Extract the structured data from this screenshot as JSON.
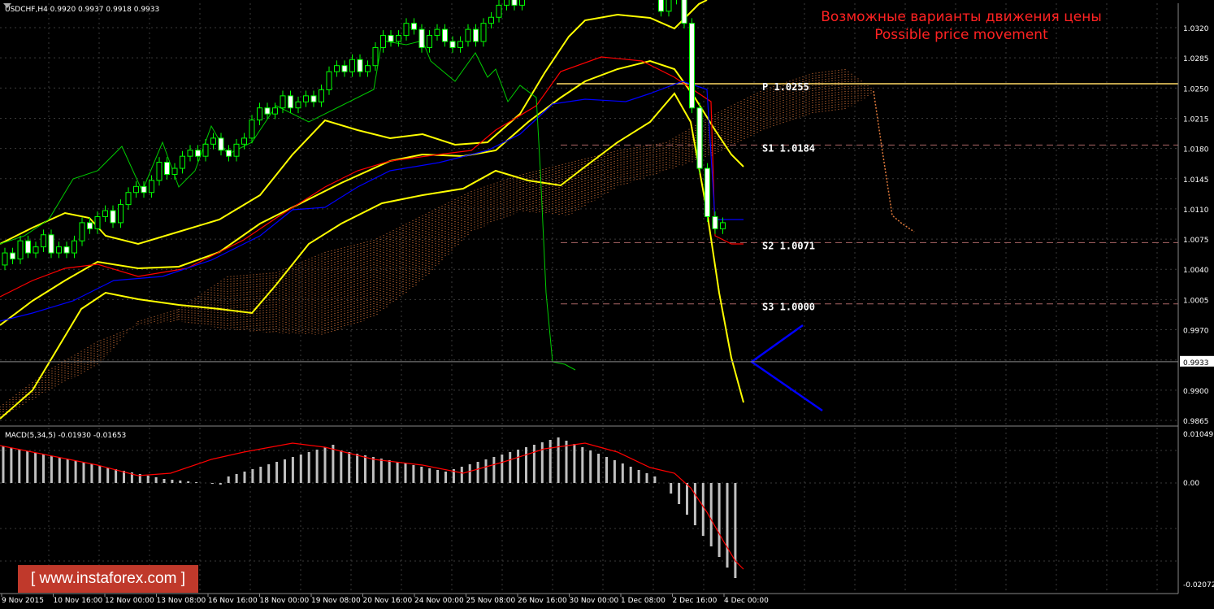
{
  "header": {
    "symbol_line": "USDCHF,H4 0.9920 0.9937 0.9918 0.9933",
    "annotation_ru": "Возможные варианты движения цены",
    "annotation_en": "Possible price movement"
  },
  "colors": {
    "background": "#000000",
    "grid": "#3a3a3a",
    "bull_candle": "#00ff00",
    "bear_candle": "#00ff00",
    "bollinger": "#ffff00",
    "kijun": "#ff0000",
    "tenkan": "#0000ff",
    "chikou": "#00cc00",
    "cloud": "#e07a3c",
    "pivot_line": "#ffd966",
    "support_line": "#aa6666",
    "forecast_arrow": "#0000ff",
    "macd_hist": "#c0c0c0",
    "macd_signal": "#ff0000",
    "annotation": "#ff2222",
    "watermark_bg": "#c0392b"
  },
  "price_axis": {
    "labels": [
      "1.0320",
      "1.0285",
      "1.0250",
      "1.0215",
      "1.0180",
      "1.0145",
      "1.0110",
      "1.0075",
      "1.0040",
      "1.0005",
      "0.9970",
      "0.9933",
      "0.9900",
      "0.9865"
    ],
    "current": "0.9933"
  },
  "levels": [
    {
      "name": "P",
      "value": "1.0255",
      "label": "P  1.0255"
    },
    {
      "name": "S1",
      "value": "1.0184",
      "label": "S1  1.0184"
    },
    {
      "name": "S2",
      "value": "1.0071",
      "label": "S2  1.0071"
    },
    {
      "name": "S3",
      "value": "1.0000",
      "label": "S3  1.0000"
    }
  ],
  "time_axis": [
    "9 Nov 2015",
    "10 Nov 16:00",
    "12 Nov 00:00",
    "13 Nov 08:00",
    "16 Nov 16:00",
    "18 Nov 00:00",
    "19 Nov 08:00",
    "20 Nov 16:00",
    "24 Nov 00:00",
    "25 Nov 08:00",
    "26 Nov 16:00",
    "30 Nov 00:00",
    "1 Dec 08:00",
    "2 Dec 16:00",
    "4 Dec 00:00"
  ],
  "macd": {
    "label": "MACD(5,34,5) -0.01930 -0.01653",
    "axis_labels": [
      "0.01049",
      "0.00",
      "-0.02072"
    ]
  },
  "watermark": {
    "open": "[",
    "text": "www.instaforex.com",
    "close": "]"
  }
}
